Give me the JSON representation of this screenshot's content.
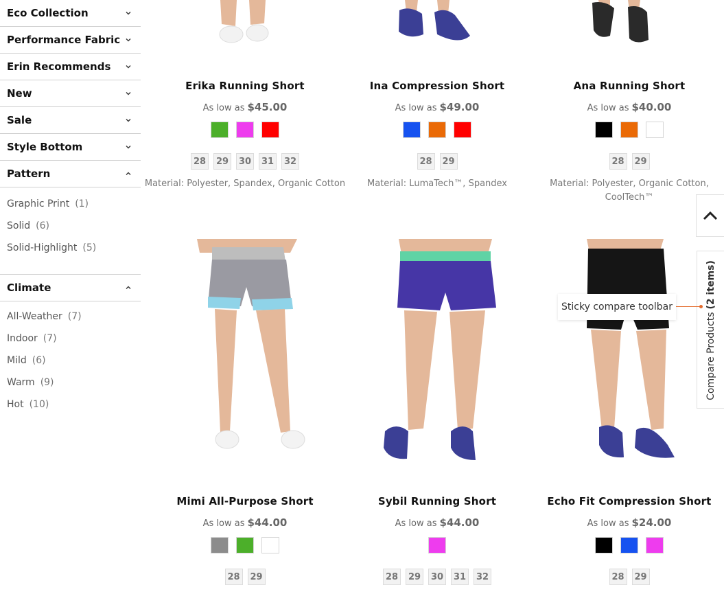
{
  "filters": {
    "collapsed": [
      {
        "label": "Eco Collection"
      },
      {
        "label": "Performance Fabric"
      },
      {
        "label": "Erin Recommends"
      },
      {
        "label": "New"
      },
      {
        "label": "Sale"
      },
      {
        "label": "Style Bottom"
      }
    ],
    "pattern": {
      "label": "Pattern",
      "options": [
        {
          "label": "Graphic Print",
          "count": "(1)"
        },
        {
          "label": "Solid",
          "count": "(6)"
        },
        {
          "label": "Solid-Highlight",
          "count": "(5)"
        }
      ]
    },
    "climate": {
      "label": "Climate",
      "options": [
        {
          "label": "All-Weather",
          "count": "(7)"
        },
        {
          "label": "Indoor",
          "count": "(7)"
        },
        {
          "label": "Mild",
          "count": "(6)"
        },
        {
          "label": "Warm",
          "count": "(9)"
        },
        {
          "label": "Hot",
          "count": "(10)"
        }
      ]
    }
  },
  "price_prefix": "As low as",
  "products": [
    {
      "name": "Erika Running Short",
      "price": "$45.00",
      "colors": [
        "#4caf2a",
        "#ee3cee",
        "#ff0000"
      ],
      "sizes": [
        "28",
        "29",
        "30",
        "31",
        "32"
      ],
      "material": "Material: Polyester, Spandex, Organic Cotton"
    },
    {
      "name": "Ina Compression Short",
      "price": "$49.00",
      "colors": [
        "#1652f0",
        "#ea6a06",
        "#ff0000"
      ],
      "sizes": [
        "28",
        "29"
      ],
      "material": "Material: LumaTech™, Spandex"
    },
    {
      "name": "Ana Running Short",
      "price": "$40.00",
      "colors": [
        "#000000",
        "#ea6a06",
        "#ffffff"
      ],
      "sizes": [
        "28",
        "29"
      ],
      "material": "Material: Polyester, Organic Cotton, CoolTech™"
    },
    {
      "name": "Mimi All-Purpose Short",
      "price": "$44.00",
      "colors": [
        "#8c8c8c",
        "#4caf2a",
        "#ffffff"
      ],
      "sizes": [
        "28",
        "29"
      ],
      "material": ""
    },
    {
      "name": "Sybil Running Short",
      "price": "$44.00",
      "colors": [
        "#ee3cee"
      ],
      "sizes": [
        "28",
        "29",
        "30",
        "31",
        "32"
      ],
      "material": ""
    },
    {
      "name": "Echo Fit Compression Short",
      "price": "$24.00",
      "colors": [
        "#000000",
        "#1652f0",
        "#ee3cee"
      ],
      "sizes": [
        "28",
        "29"
      ],
      "material": ""
    }
  ],
  "compare": {
    "label": "Compare Products",
    "items": "(2 items)"
  },
  "tooltip": "Sticky compare toolbar"
}
